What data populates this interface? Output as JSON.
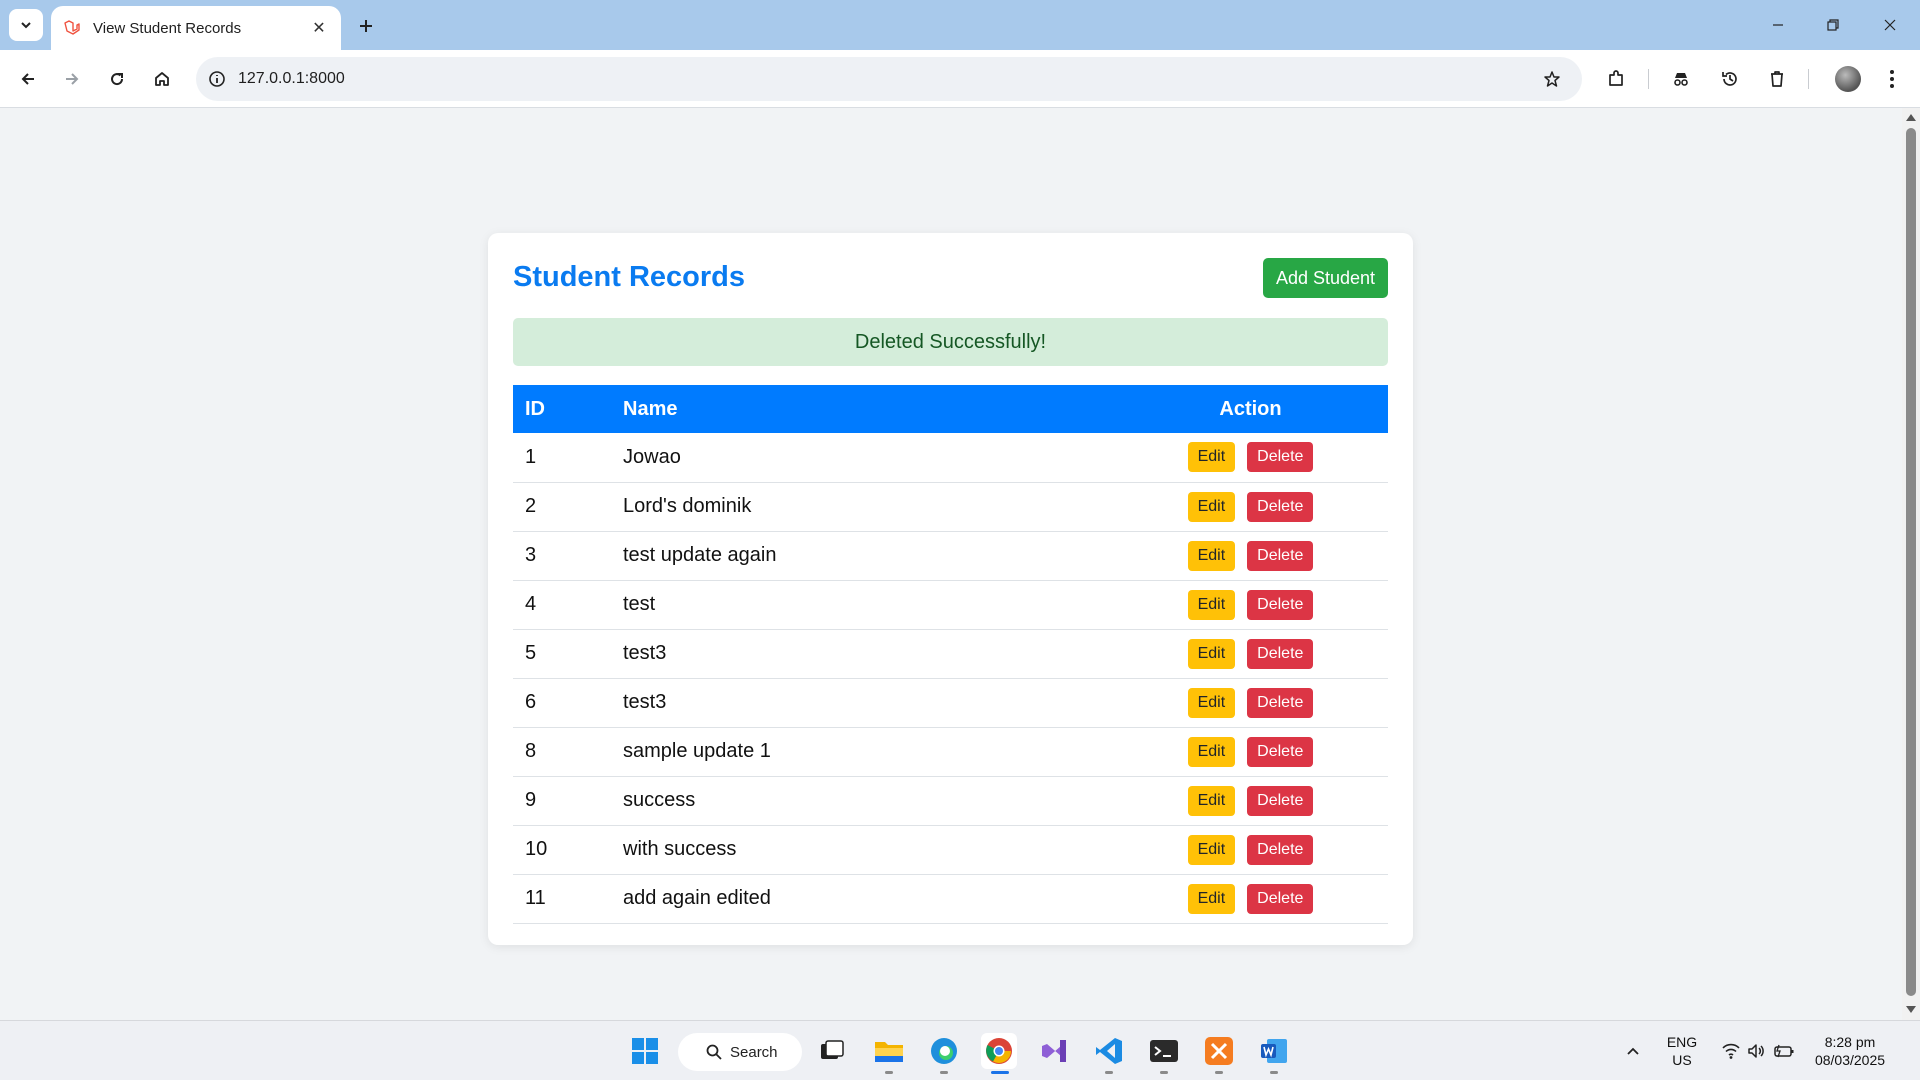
{
  "browser": {
    "tab_title": "View Student Records",
    "url": "127.0.0.1:8000"
  },
  "page": {
    "title": "Student Records",
    "add_button": "Add Student",
    "alert": "Deleted Successfully!",
    "columns": {
      "id": "ID",
      "name": "Name",
      "action": "Action"
    },
    "edit_label": "Edit",
    "delete_label": "Delete",
    "rows": [
      {
        "id": "1",
        "name": "Jowao"
      },
      {
        "id": "2",
        "name": "Lord's dominik"
      },
      {
        "id": "3",
        "name": "test update again"
      },
      {
        "id": "4",
        "name": "test"
      },
      {
        "id": "5",
        "name": "test3"
      },
      {
        "id": "6",
        "name": "test3"
      },
      {
        "id": "8",
        "name": "sample update 1"
      },
      {
        "id": "9",
        "name": "success"
      },
      {
        "id": "10",
        "name": "with success"
      },
      {
        "id": "11",
        "name": "add again edited"
      }
    ]
  },
  "taskbar": {
    "search_label": "Search",
    "lang_line1": "ENG",
    "lang_line2": "US",
    "time": "8:28 pm",
    "date": "08/03/2025"
  },
  "colors": {
    "accent": "#007bff",
    "title": "#0a7bf0",
    "success_button": "#28a745",
    "alert_bg": "#d4edda",
    "edit_button": "#ffc107",
    "delete_button": "#dc3545"
  }
}
